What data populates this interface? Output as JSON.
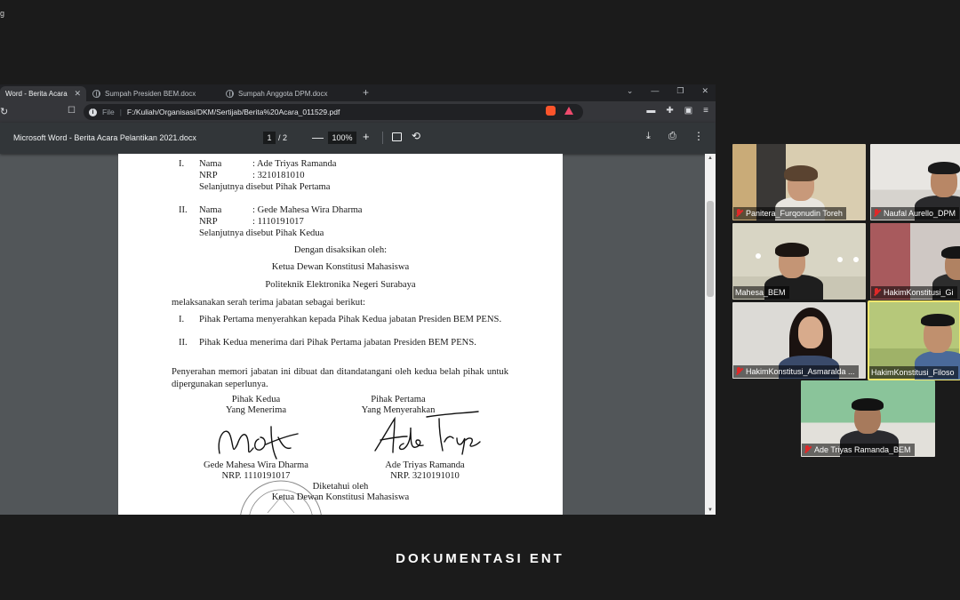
{
  "corner_text": "g",
  "browser": {
    "tabs": [
      {
        "label": "Word - Berita Acara Pel",
        "active": true
      },
      {
        "label": "Sumpah Presiden BEM.docx",
        "active": false
      },
      {
        "label": "Sumpah Anggota DPM.docx",
        "active": false
      }
    ],
    "address": {
      "scheme_label": "File",
      "url": "F:/Kuliah/Organisasi/DKM/Sertijab/Berita%20Acara_011529.pdf"
    },
    "pdf": {
      "title": "Microsoft Word - Berita Acara Pelantikan 2021.docx",
      "page_current": "1",
      "page_total": "/  2",
      "zoom": "100%"
    }
  },
  "document": {
    "p1": {
      "numeral": "I.",
      "nama_label": "Nama",
      "nama_value": ": Ade Triyas Ramanda",
      "nrp_label": "NRP",
      "nrp_value": ": 3210181010",
      "note": "Selanjutnya disebut Pihak Pertama"
    },
    "p2": {
      "numeral": "II.",
      "nama_label": "Nama",
      "nama_value": ": Gede Mahesa Wira Dharma",
      "nrp_label": "NRP",
      "nrp_value": ": 1110191017",
      "note": "Selanjutnya disebut Pihak Kedua"
    },
    "witness_intro": "Dengan disaksikan oleh:",
    "witness_title": "Ketua Dewan Konstitusi Mahasiswa",
    "witness_org": "Politeknik Elektronika Negeri Surabaya",
    "handover_intro": "melaksanakan serah terima jabatan sebagai berikut:",
    "items": [
      {
        "numeral": "I.",
        "text": "Pihak Pertama menyerahkan kepada Pihak Kedua jabatan Presiden BEM PENS."
      },
      {
        "numeral": "II.",
        "text": "Pihak Kedua menerima dari Pihak Pertama jabatan Presiden BEM PENS."
      }
    ],
    "closing": "Penyerahan memori jabatan ini dibuat dan ditandatangani oleh kedua belah pihak untuk dipergunakan seperlunya.",
    "sign_left": {
      "role": "Pihak Kedua",
      "subrole": "Yang Menerima",
      "name": "Gede Mahesa Wira Dharma",
      "nrp": "NRP. 1110191017"
    },
    "sign_right": {
      "role": "Pihak Pertama",
      "subrole": "Yang Menyerahkan",
      "name": "Ade Triyas Ramanda",
      "nrp": "NRP. 3210191010"
    },
    "known_by": "Diketahui oleh",
    "known_title": "Ketua Dewan Konstitusi Mahasiswa"
  },
  "participants": [
    {
      "name": "Panitera_Furqonudin Toreh",
      "muted": true
    },
    {
      "name": "Naufal Aurello_DPM",
      "muted": true
    },
    {
      "name": "Mahesa_BEM",
      "muted": false
    },
    {
      "name": "HakimKonstitusi_Gi",
      "muted": true
    },
    {
      "name": "HakimKonstitusi_Asmaralda ...",
      "muted": true
    },
    {
      "name": "HakimKonstitusi_Filoso",
      "muted": false,
      "speaking": true
    },
    {
      "name": "Ade Triyas Ramanda_BEM",
      "muted": true
    }
  ],
  "caption": "DOKUMENTASI ENT",
  "colors": {
    "accent_speaking": "#f2e66d",
    "muted_mic": "#e02828",
    "pdf_toolbar": "#323639",
    "viewer_bg": "#525659"
  }
}
